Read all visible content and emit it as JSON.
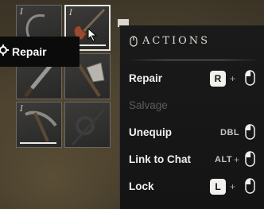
{
  "tooltip": {
    "label": "Repair"
  },
  "panel": {
    "title": "ACTIONS",
    "actions": [
      {
        "label": "Repair",
        "key": "R",
        "plus": "+",
        "enabled": true
      },
      {
        "label": "Salvage",
        "enabled": false
      },
      {
        "label": "Unequip",
        "key": "DBL",
        "enabled": true
      },
      {
        "label": "Link to Chat",
        "key": "ALT",
        "plus": "+",
        "enabled": true
      },
      {
        "label": "Lock",
        "key": "L",
        "plus": "+",
        "enabled": true
      }
    ]
  },
  "inventory": {
    "slots": [
      {
        "item": "sickle-icon",
        "tier": "I",
        "durability": 1.0
      },
      {
        "item": "hatchet-icon",
        "tier": "I",
        "durability": 1.0,
        "hovered": true
      },
      {
        "item": "skinning-knife-icon",
        "tier": "",
        "durability": 1.0
      },
      {
        "item": "woodcutting-axe-icon",
        "tier": "",
        "durability": 1.0
      },
      {
        "item": "pickaxe-icon",
        "tier": "I",
        "durability": 1.0
      },
      {
        "item": "fishing-pole-icon",
        "tier": "",
        "durability": 0
      }
    ]
  },
  "colors": {
    "panel_bg": "#161617",
    "text": "#f2f0ec",
    "disabled": "#5d5c59",
    "key_bg": "#f1f0ec"
  }
}
